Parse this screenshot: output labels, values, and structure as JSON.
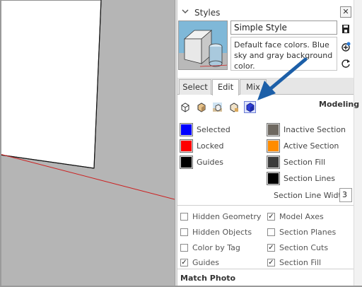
{
  "styles_panel": {
    "title": "Styles",
    "style_name": "Simple Style",
    "style_description": "Default face colors. Blue sky and gray background color.",
    "tabs": [
      {
        "label": "Select"
      },
      {
        "label": "Edit",
        "active": true
      },
      {
        "label": "Mix"
      }
    ],
    "toolbar_section_label": "Modeling",
    "toolbar_icons": [
      "edge-settings-icon",
      "face-settings-icon",
      "background-settings-icon",
      "watermark-settings-icon",
      "modeling-settings-icon"
    ],
    "selected_toolbar_icon": "modeling-settings-icon"
  },
  "modeling_colors": {
    "left": [
      {
        "label": "Selected",
        "color": "#0000ff"
      },
      {
        "label": "Locked",
        "color": "#ff0000"
      },
      {
        "label": "Guides",
        "color": "#000000"
      }
    ],
    "right": [
      {
        "label": "Inactive Section",
        "color": "#6e6860"
      },
      {
        "label": "Active Section",
        "color": "#ff8c00"
      },
      {
        "label": "Section Fill",
        "color": "#3c3c3c"
      },
      {
        "label": "Section Lines",
        "color": "#000000"
      }
    ],
    "section_line_width_label": "Section Line Width",
    "section_line_width_value": "3"
  },
  "visibility_options": {
    "left": [
      {
        "label": "Hidden Geometry",
        "checked": false
      },
      {
        "label": "Hidden Objects",
        "checked": false
      },
      {
        "label": "Color by Tag",
        "checked": false
      },
      {
        "label": "Guides",
        "checked": true
      }
    ],
    "right": [
      {
        "label": "Model Axes",
        "checked": true
      },
      {
        "label": "Section Planes",
        "checked": false
      },
      {
        "label": "Section Cuts",
        "checked": true
      },
      {
        "label": "Section Fill",
        "checked": true
      }
    ]
  },
  "match_photo_label": "Match Photo",
  "colors": {
    "annotation_arrow": "#1c5fa8",
    "selected_tool_highlight": "#6b7dd6",
    "viewport_background": "#b5b5b5"
  }
}
